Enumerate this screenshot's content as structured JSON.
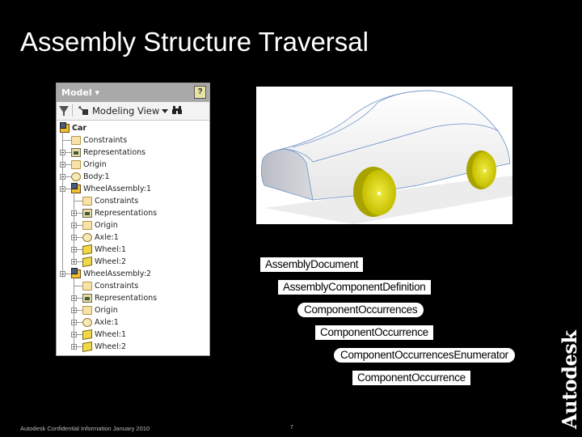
{
  "slide": {
    "title": "Assembly Structure Traversal",
    "footer": "Autodesk Confidential Information January 2010",
    "page_number": "7",
    "logo": "Autodesk"
  },
  "browser": {
    "header_title": "Model ▾",
    "help_icon": "?",
    "toolbar": {
      "filter_icon": "filter-icon",
      "view_label": "Modeling View",
      "dropdown_icon": "chevron-down-icon",
      "find_icon": "🔭"
    },
    "tree": [
      {
        "label": "Car",
        "icon": "assembly",
        "level": 0,
        "expander": "none",
        "bold": true
      },
      {
        "label": "Constraints",
        "icon": "folder",
        "level": 1,
        "expander": "none"
      },
      {
        "label": "Representations",
        "icon": "representations",
        "level": 1,
        "expander": "plus"
      },
      {
        "label": "Origin",
        "icon": "folder",
        "level": 1,
        "expander": "plus"
      },
      {
        "label": "Body:1",
        "icon": "body",
        "level": 1,
        "expander": "plus"
      },
      {
        "label": "WheelAssembly:1",
        "icon": "assembly",
        "level": 1,
        "expander": "minus"
      },
      {
        "label": "Constraints",
        "icon": "folder",
        "level": 2,
        "expander": "none"
      },
      {
        "label": "Representations",
        "icon": "representations",
        "level": 2,
        "expander": "plus"
      },
      {
        "label": "Origin",
        "icon": "folder",
        "level": 2,
        "expander": "plus"
      },
      {
        "label": "Axle:1",
        "icon": "body",
        "level": 2,
        "expander": "plus"
      },
      {
        "label": "Wheel:1",
        "icon": "part",
        "level": 2,
        "expander": "plus"
      },
      {
        "label": "Wheel:2",
        "icon": "part",
        "level": 2,
        "expander": "plus"
      },
      {
        "label": "WheelAssembly:2",
        "icon": "assembly",
        "level": 1,
        "expander": "minus"
      },
      {
        "label": "Constraints",
        "icon": "folder",
        "level": 2,
        "expander": "none"
      },
      {
        "label": "Representations",
        "icon": "representations",
        "level": 2,
        "expander": "plus"
      },
      {
        "label": "Origin",
        "icon": "folder",
        "level": 2,
        "expander": "plus"
      },
      {
        "label": "Axle:1",
        "icon": "body",
        "level": 2,
        "expander": "plus"
      },
      {
        "label": "Wheel:1",
        "icon": "part",
        "level": 2,
        "expander": "plus"
      },
      {
        "label": "Wheel:2",
        "icon": "part",
        "level": 2,
        "expander": "plus"
      }
    ]
  },
  "car_image": {
    "description": "3D car model with white body and yellow wheels",
    "body_color": "#f2f2f2",
    "wheel_color": "#d9d400",
    "edge_color": "#5a86c8"
  },
  "hierarchy": [
    {
      "label": "AssemblyDocument",
      "shape": "rect"
    },
    {
      "label": "AssemblyComponentDefinition",
      "shape": "rect"
    },
    {
      "label": "ComponentOccurrences",
      "shape": "pill"
    },
    {
      "label": "ComponentOccurrence",
      "shape": "rect"
    },
    {
      "label": "ComponentOccurrencesEnumerator",
      "shape": "pill"
    },
    {
      "label": "ComponentOccurrence",
      "shape": "rect"
    }
  ]
}
